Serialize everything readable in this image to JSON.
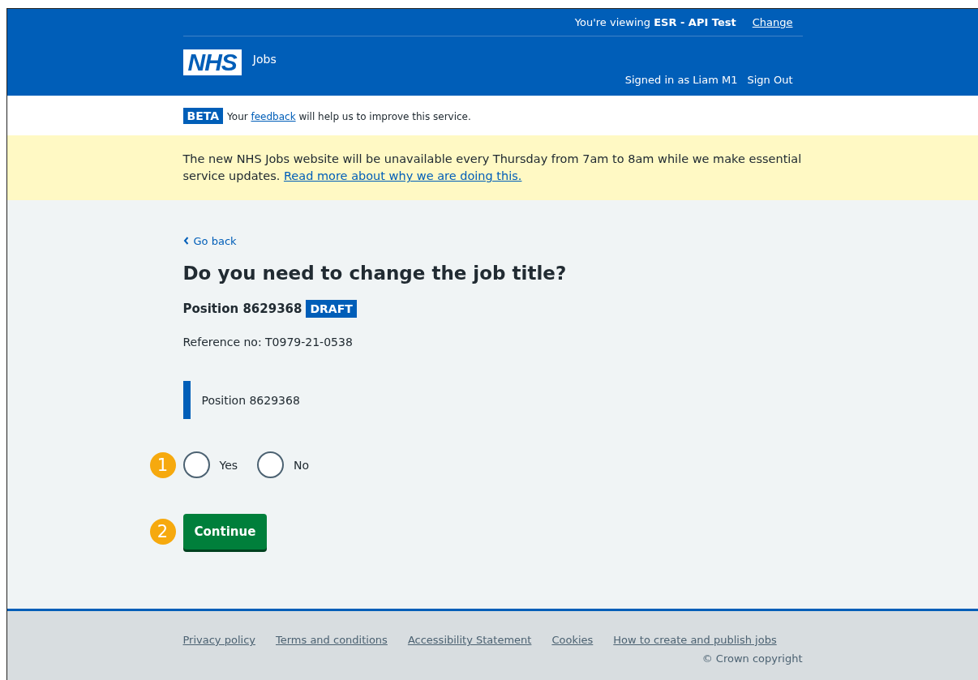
{
  "header": {
    "viewing_prefix": "You're viewing ",
    "viewing_org": "ESR - API Test",
    "change_link": "Change",
    "logo": "NHS",
    "service_name": "Jobs",
    "signed_in": "Signed in as Liam M1",
    "sign_out": "Sign Out"
  },
  "phase_banner": {
    "tag": "BETA",
    "text_before": "Your ",
    "link": "feedback",
    "text_after": " will help us to improve this service."
  },
  "notice": {
    "text": "The new NHS Jobs website will be unavailable every Thursday from 7am to 8am while we make essential service updates. ",
    "link": "Read more about why we are doing this."
  },
  "back_link": "Go back",
  "heading": "Do you need to change the job title?",
  "position": {
    "title": "Position 8629368",
    "tag": "DRAFT"
  },
  "reference": "Reference no: T0979-21-0538",
  "inset_text": "Position 8629368",
  "callouts": [
    "1",
    "2"
  ],
  "radios": [
    {
      "label": "Yes",
      "selected": false
    },
    {
      "label": "No",
      "selected": false
    }
  ],
  "continue_button": "Continue",
  "footer": {
    "links": [
      "Privacy policy",
      "Terms and conditions",
      "Accessibility Statement",
      "Cookies",
      "How to create and publish jobs"
    ],
    "copyright": "© Crown copyright"
  }
}
